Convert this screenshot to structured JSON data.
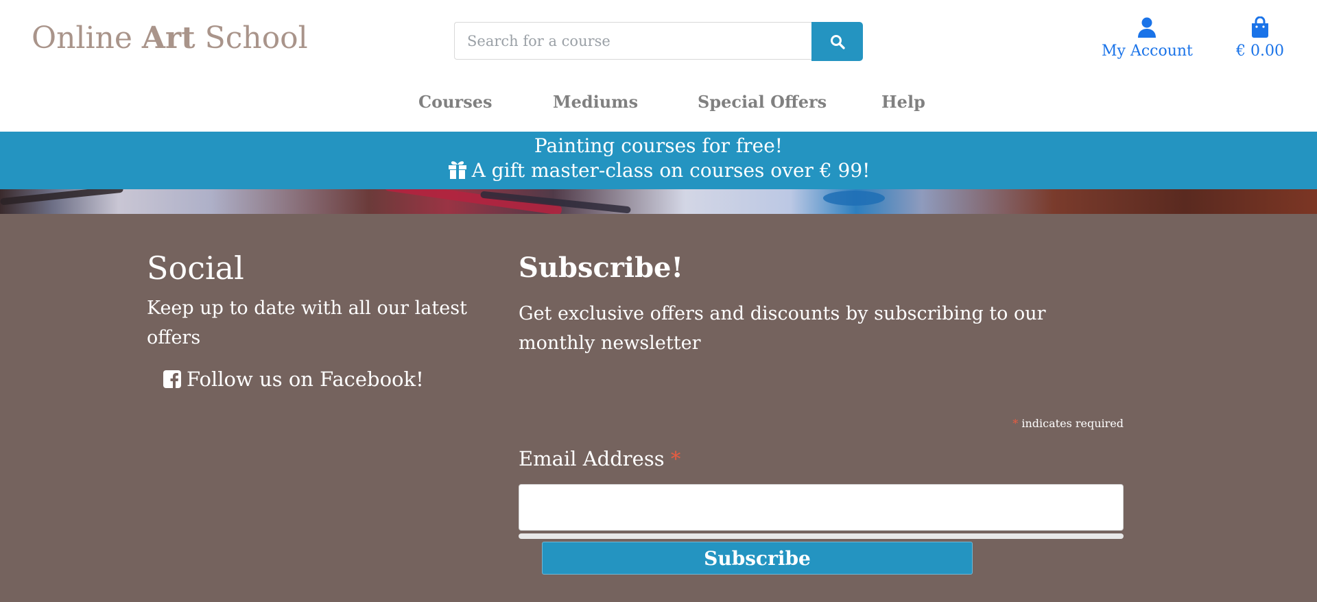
{
  "header": {
    "logo": {
      "part1": "Online ",
      "part2": "Art",
      "part3": " School"
    },
    "search": {
      "placeholder": "Search for a course",
      "icon": "search-icon"
    },
    "account": {
      "label": "My Account",
      "icon": "user-icon"
    },
    "cart": {
      "total": "€ 0.00",
      "icon": "shopping-bag-icon"
    },
    "nav": [
      {
        "label": "Courses"
      },
      {
        "label": "Mediums"
      },
      {
        "label": "Special Offers"
      },
      {
        "label": "Help"
      }
    ]
  },
  "promo": {
    "line1": "Painting courses for free!",
    "line2": "A gift master-class on courses over € 99!",
    "icon": "gift-icon"
  },
  "footer": {
    "social": {
      "title": "Social",
      "text": "Keep up to date with all our latest offers",
      "facebook_link": "Follow us on Facebook!",
      "icon": "facebook-square-icon"
    },
    "subscribe": {
      "title": "Subscribe!",
      "description": "Get exclusive offers and discounts by subscribing to our monthly newsletter",
      "required_star": "*",
      "required_note": " indicates required",
      "email_label": "Email Address ",
      "email_value": "",
      "button_label": "Subscribe"
    }
  },
  "colors": {
    "brand_blue": "#2494c1",
    "logo_taupe": "#a9948a",
    "footer_bg": "#75635e",
    "link_blue": "#1a73e8",
    "required_red": "#e85c41"
  }
}
